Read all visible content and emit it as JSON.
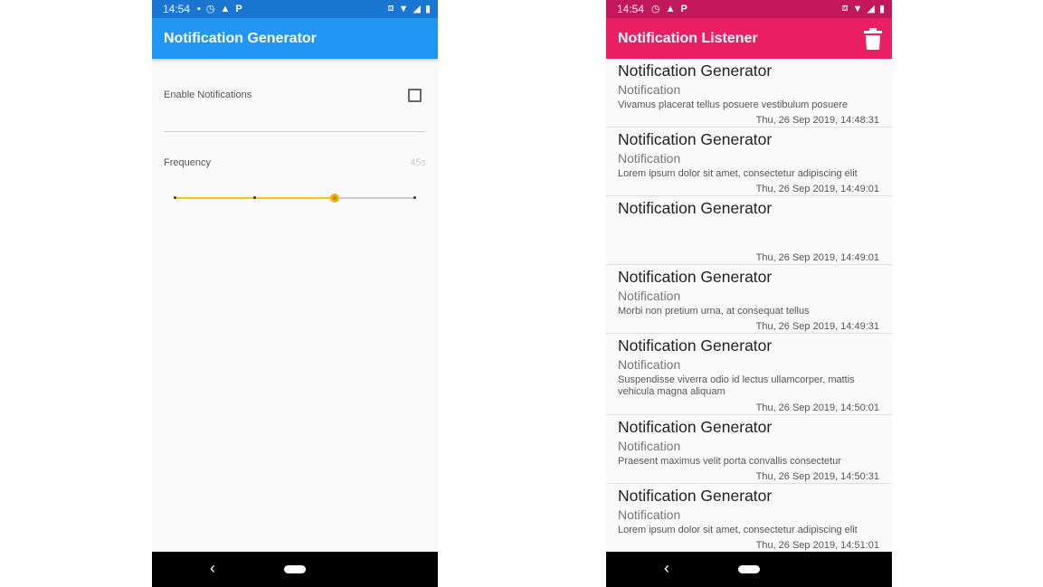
{
  "status_bar": {
    "time": "14:54"
  },
  "left_app": {
    "title": "Notification Generator",
    "enable_label": "Enable Notifications",
    "enable_checked": false,
    "frequency_label": "Frequency",
    "frequency_value": "45s",
    "slider": {
      "steps": 4,
      "selected_index": 2
    }
  },
  "right_app": {
    "title": "Notification Listener",
    "notifications": [
      {
        "title": "Notification Generator",
        "subtitle": "Notification",
        "body": "Vivamus placerat tellus posuere vestibulum posuere",
        "date": "Thu, 26 Sep 2019, 14:48:31"
      },
      {
        "title": "Notification Generator",
        "subtitle": "Notification",
        "body": "Lorem ipsum dolor sit amet, consectetur adipiscing elit",
        "date": "Thu, 26 Sep 2019, 14:49:01"
      },
      {
        "title": "Notification Generator",
        "subtitle": "",
        "body": "",
        "date": "Thu, 26 Sep 2019, 14:49:01"
      },
      {
        "title": "Notification Generator",
        "subtitle": "Notification",
        "body": "Morbi non pretium urna, at consequat tellus",
        "date": "Thu, 26 Sep 2019, 14:49:31"
      },
      {
        "title": "Notification Generator",
        "subtitle": "Notification",
        "body": "Suspendisse viverra odio id lectus ullamcorper, mattis vehicula magna aliquam",
        "date": "Thu, 26 Sep 2019, 14:50:01"
      },
      {
        "title": "Notification Generator",
        "subtitle": "Notification",
        "body": "Praesent maximus velit porta convallis consectetur",
        "date": "Thu, 26 Sep 2019, 14:50:31"
      },
      {
        "title": "Notification Generator",
        "subtitle": "Notification",
        "body": "Lorem ipsum dolor sit amet, consectetur adipiscing elit",
        "date": "Thu, 26 Sep 2019, 14:51:01"
      }
    ]
  }
}
